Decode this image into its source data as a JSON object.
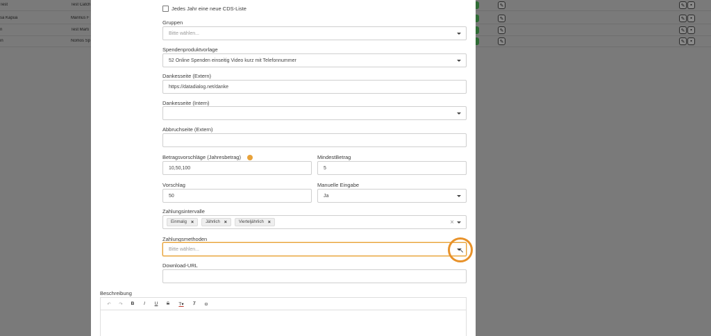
{
  "background_table": {
    "rows": [
      {
        "col1": "Test",
        "col2": "Test Catch"
      },
      {
        "col1": "sa Kapua",
        "col2": "Marinus F"
      },
      {
        "col1": "n",
        "col2": "Test Marti"
      },
      {
        "col1": "in",
        "col2": "Nomos Sp"
      }
    ]
  },
  "form": {
    "yearly_cds_label": "Jedes Jahr eine neue CDS-Liste",
    "groups": {
      "label": "Gruppen",
      "placeholder": "Bitte wählen..."
    },
    "product_template": {
      "label": "Spendenproduktvorlage",
      "value": "52 Online Spenden einseitig Video kurz mit Telefonnummer"
    },
    "thanks_external": {
      "label": "Dankesseite (Extern)",
      "value": "https://datadialog.net/danke"
    },
    "thanks_internal": {
      "label": "Dankesseite (Intern)",
      "value": ""
    },
    "cancel_page": {
      "label": "Abbruchseite (Extern)",
      "value": ""
    },
    "amount_suggestions": {
      "label": "Betragsvorschläge (Jahresbetrag)",
      "value": "10,50,100"
    },
    "min_amount": {
      "label": "MindestBetrag",
      "value": "5"
    },
    "suggestion": {
      "label": "Vorschlag",
      "value": "50"
    },
    "manual_input": {
      "label": "Manuelle Eingabe",
      "value": "Ja"
    },
    "payment_intervals": {
      "label": "Zahlungsintervalle",
      "chips": [
        "Einmalig",
        "Jährlich",
        "Vierteljährlich"
      ]
    },
    "payment_methods": {
      "label": "Zahlungsmethoden",
      "placeholder": "Bitte wählen..."
    },
    "download_url": {
      "label": "Download-URL",
      "value": ""
    },
    "description": {
      "label": "Beschreibung"
    }
  },
  "colors": {
    "accent": "#e8a23a",
    "highlight": "#e8922a",
    "overlay": "#7a7a7a"
  }
}
